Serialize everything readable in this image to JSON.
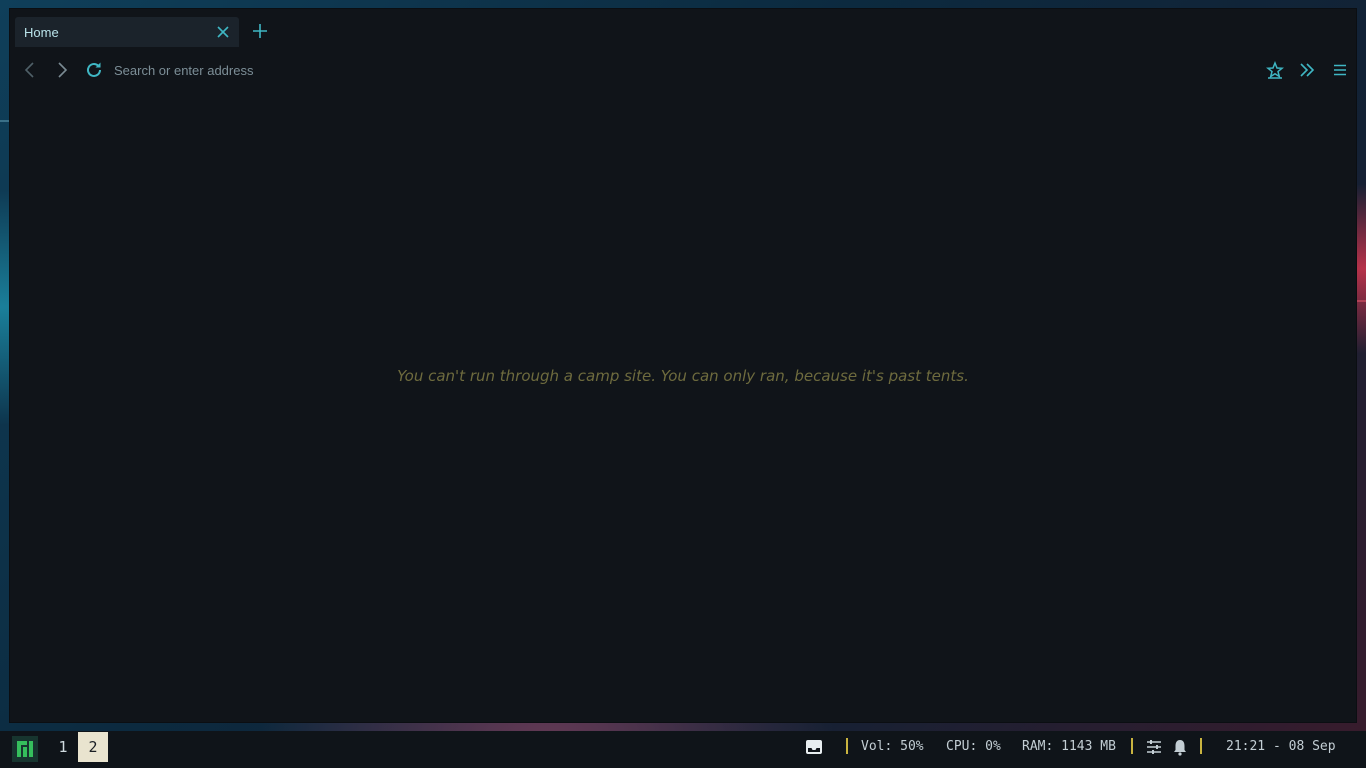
{
  "browser": {
    "tab": {
      "title": "Home"
    },
    "address_bar": {
      "placeholder": "Search or enter address",
      "value": ""
    },
    "content": {
      "message": "You can't run through a camp site. You can only ran, because it's past tents."
    }
  },
  "taskbar": {
    "workspaces": [
      {
        "label": "1",
        "active": false
      },
      {
        "label": "2",
        "active": true
      }
    ],
    "volume": "Vol: 50%",
    "cpu": "CPU: 0%",
    "ram": "RAM: 1143 MB",
    "clock": "21:21 - 08 Sep"
  },
  "colors": {
    "accent": "#3fb7c4",
    "separator": "#c9b440",
    "message": "#6e6b3e",
    "window_bg": "#101419"
  },
  "icons": {
    "tab_close": "close-icon",
    "new_tab": "plus-icon",
    "back": "chevron-left-icon",
    "forward": "chevron-right-icon",
    "reload": "reload-icon",
    "bookmarks": "star-icon",
    "overflow": "double-chevron-right-icon",
    "menu": "hamburger-menu-icon",
    "launcher": "manjaro-logo-icon",
    "tray_inbox": "inbox-icon",
    "tray_mixer": "sliders-icon",
    "tray_bell": "bell-icon"
  }
}
